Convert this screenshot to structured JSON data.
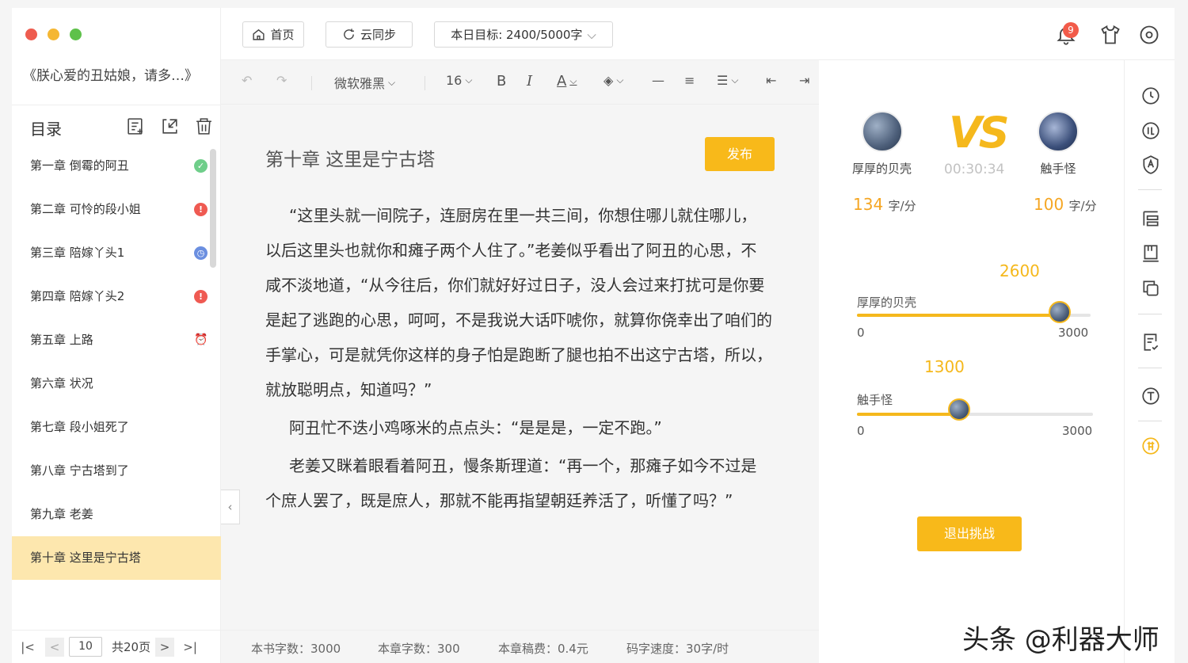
{
  "window": {
    "controls": [
      "#ee5c4f",
      "#f5b733",
      "#5ec14a"
    ]
  },
  "book": {
    "title": "《朕心爱的丑姑娘，请多…》"
  },
  "toc": {
    "title": "目录",
    "items": [
      {
        "label": "第一章 倒霉的阿丑",
        "status": "done",
        "status_color": "#6fce8a",
        "status_icon": "✓"
      },
      {
        "label": "第二章 可怜的段小姐",
        "status": "warn",
        "status_color": "#ef5a52",
        "status_icon": "!"
      },
      {
        "label": "第三章 陪嫁丫头1",
        "status": "pending",
        "status_color": "#6b8fe0",
        "status_icon": "◷"
      },
      {
        "label": "第四章 陪嫁丫头2",
        "status": "warn",
        "status_color": "#ef5a52",
        "status_icon": "!"
      },
      {
        "label": "第五章 上路",
        "status": "alarm",
        "status_color": "#bbbbbb",
        "status_icon": "⏰"
      },
      {
        "label": "第六章 状况"
      },
      {
        "label": "第七章 段小姐死了"
      },
      {
        "label": "第八章 宁古塔到了"
      },
      {
        "label": "第九章 老姜"
      },
      {
        "label": "第十章 这里是宁古塔",
        "active": true
      }
    ]
  },
  "pager": {
    "current": "10",
    "total": "共20页"
  },
  "topbar": {
    "home": "首页",
    "sync": "云同步",
    "goal": "本日目标: 2400/5000字",
    "notifications": "9"
  },
  "toolbar": {
    "font": "微软雅黑",
    "size": "16"
  },
  "editor": {
    "chapter_title": "第十章  这里是宁古塔",
    "publish": "发布",
    "paragraphs": [
      "“这里头就一间院子，连厨房在里一共三间，你想住哪儿就住哪儿，以后这里头也就你和瘫子两个人住了。”老姜似乎看出了阿丑的心思，不咸不淡地道，“从今往后，你们就好好过日子，没人会过来打扰可是你要是起了逃跑的心思，呵呵，不是我说大话吓唬你，就算你侥幸出了咱们的手掌心，可是就凭你这样的身子怕是跑断了腿也拍不出这宁古塔，所以，就放聪明点，知道吗？”",
      "阿丑忙不迭小鸡啄米的点点头：“是是是，一定不跑。”",
      "老姜又眯着眼看着阿丑，慢条斯理道：“再一个，那瘫子如今不过是个庶人罢了，既是庶人，那就不能再指望朝廷养活了，听懂了吗？”"
    ]
  },
  "status": {
    "book_words": "本书字数：3000",
    "chapter_words": "本章字数：300",
    "fee": "本章稿费：0.4元",
    "speed": "码字速度：30字/时"
  },
  "challenge": {
    "vs": "VS",
    "timer": "00:30:34",
    "player1": {
      "name": "厚厚的贝壳",
      "speed": "134",
      "value": "2600"
    },
    "player2": {
      "name": "触手怪",
      "speed": "100",
      "value": "1300"
    },
    "speed_unit": "字/分",
    "min": "0",
    "max": "3000",
    "progress1": 0.867,
    "progress2": 0.433,
    "quit": "退出挑战"
  },
  "watermark": "头条 @利器大师"
}
